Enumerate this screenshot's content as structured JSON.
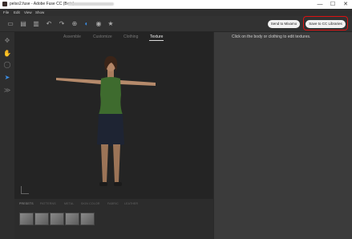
{
  "window": {
    "title": "pelso2.fuse - Adobe Fuse CC (Beta)",
    "controls": {
      "minimize": "—",
      "maximize": "☐",
      "close": "✕"
    }
  },
  "menu": [
    "File",
    "Edit",
    "View",
    "Show"
  ],
  "toolbar": {
    "send_mixamo": "Send to Mixamo",
    "save_libraries": "Save to CC Libraries",
    "icons": [
      "new-file-icon",
      "save-icon",
      "import-icon",
      "undo-icon",
      "redo-icon",
      "settings-circle-icon",
      "pen-icon",
      "globe-icon",
      "star-icon"
    ]
  },
  "tabs": [
    {
      "label": "Assemble",
      "active": false
    },
    {
      "label": "Customize",
      "active": false
    },
    {
      "label": "Clothing",
      "active": false
    },
    {
      "label": "Texture",
      "active": true
    }
  ],
  "texture_categories": [
    "PRESETS",
    "PATTERNS",
    "METAL",
    "SKIN COLOR",
    "FABRIC",
    "LEATHER"
  ],
  "right_panel": {
    "hint": "Click on the body or clothing to edit textures."
  },
  "colors": {
    "highlight": "#dd1111",
    "viewport_bg": "#242424",
    "shirt": "#3e6b2e",
    "skirt": "#1e2433"
  }
}
